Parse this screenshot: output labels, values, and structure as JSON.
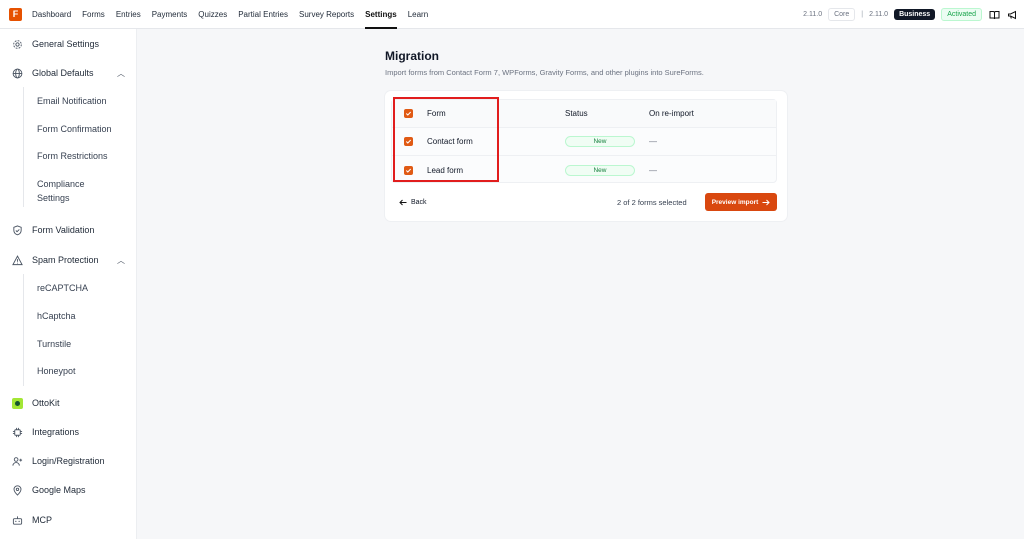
{
  "topbar": {
    "logo_letter": "F",
    "nav": [
      {
        "label": "Dashboard",
        "active": false
      },
      {
        "label": "Forms",
        "active": false
      },
      {
        "label": "Entries",
        "active": false
      },
      {
        "label": "Payments",
        "active": false
      },
      {
        "label": "Quizzes",
        "active": false
      },
      {
        "label": "Partial Entries",
        "active": false
      },
      {
        "label": "Survey Reports",
        "active": false
      },
      {
        "label": "Settings",
        "active": true
      },
      {
        "label": "Learn",
        "active": false
      }
    ],
    "core_version": "2.11.0",
    "core_label": "Core",
    "separator": "|",
    "business_version": "2.11.0",
    "business_label": "Business",
    "activated_label": "Activated"
  },
  "sidebar": {
    "general_settings": "General Settings",
    "global_defaults": "Global Defaults",
    "global_sub": [
      "Email Notification",
      "Form Confirmation",
      "Form Restrictions",
      "Compliance Settings"
    ],
    "form_validation": "Form Validation",
    "spam_protection": "Spam Protection",
    "spam_sub": [
      "reCAPTCHA",
      "hCaptcha",
      "Turnstile",
      "Honeypot"
    ],
    "ottokit": "OttoKit",
    "integrations": "Integrations",
    "login_registration": "Login/Registration",
    "google_maps": "Google Maps",
    "mcp": "MCP"
  },
  "main": {
    "title": "Migration",
    "description": "Import forms from Contact Form 7, WPForms, Gravity Forms, and other plugins into SureForms.",
    "table": {
      "headers": {
        "form": "Form",
        "status": "Status",
        "reimport": "On re-import"
      },
      "rows": [
        {
          "form": "Contact form",
          "status": "New",
          "reimport": "—",
          "checked": true
        },
        {
          "form": "Lead form",
          "status": "New",
          "reimport": "—",
          "checked": true
        }
      ]
    },
    "back_label": "Back",
    "selected_text": "2 of 2 forms selected",
    "preview_label": "Preview import"
  },
  "colors": {
    "accent": "#d9480f",
    "highlight": "#e11d1d",
    "status_green": "#15803d"
  }
}
